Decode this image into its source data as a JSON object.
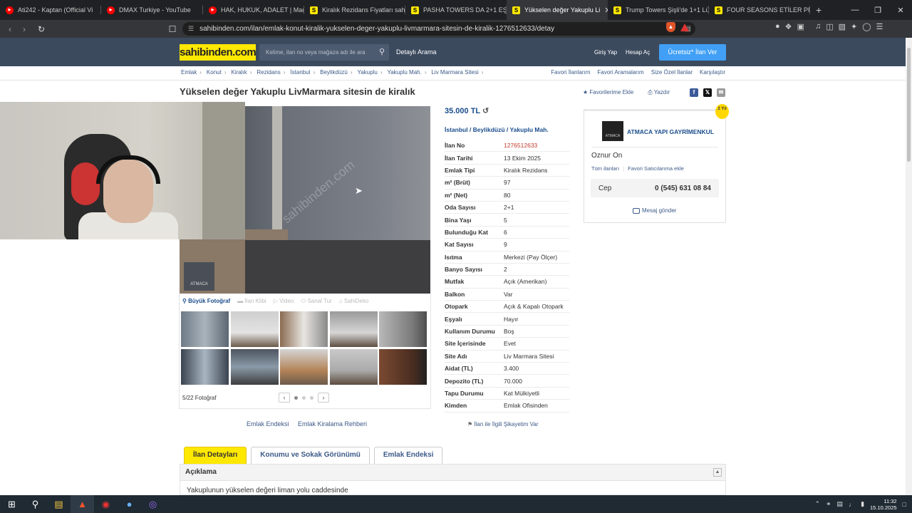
{
  "browser": {
    "tabs": [
      {
        "title": "Ati242 - Kaptan (Official Vi",
        "icon": "youtube-icon",
        "color": "#ff0000",
        "active": false
      },
      {
        "title": "DMAX Turkiye - YouTube",
        "icon": "youtube-icon",
        "color": "#ff0000",
        "active": false
      },
      {
        "title": "HAK, HUKUK, ADALET | Madara",
        "icon": "youtube-icon",
        "color": "#ff0000",
        "active": false
      },
      {
        "title": "Kiralık Rezidans Fiyatları sahibi",
        "icon": "sahibinden-icon",
        "color": "#ffe800",
        "active": false
      },
      {
        "title": "PASHA TOWERS DA 2+1 EŞYAL",
        "icon": "sahibinden-icon",
        "color": "#ffe800",
        "active": false
      },
      {
        "title": "Yükselen değer Yakuplu Li",
        "icon": "sahibinden-icon",
        "color": "#ffe800",
        "active": true
      },
      {
        "title": "Trump Towers Şişli'de 1+1 Lük",
        "icon": "sahibinden-icon",
        "color": "#ffe800",
        "active": false
      },
      {
        "title": "FOUR SEASONS ETİLER PRİVAT",
        "icon": "sahibinden-icon",
        "color": "#ffe800",
        "active": false
      }
    ],
    "url": "sahibinden.com/ilan/emlak-konut-kiralik-yukselen-deger-yakuplu-livmarmara-sitesin-de-kiralik-1276512633/detay"
  },
  "site": {
    "logo": "sahibinden.com",
    "search_placeholder": "Kelime, ilan no veya mağaza adı ile ara",
    "detailed_search": "Detaylı Arama",
    "login": "Giriş Yap",
    "register": "Hesap Aç",
    "post_ad": "Ücretsiz* İlan Ver",
    "brand_yellow": "#ffe800",
    "header_color": "#3c4a5e"
  },
  "breadcrumbs": [
    "Emlak",
    "Konut",
    "Kiralık",
    "Rezidans",
    "İstanbul",
    "Beylikdüzü",
    "Yakuplu",
    "Yakuplu Mah.",
    "Liv Marmara Sitesi"
  ],
  "top_links": [
    "Favori İlanlarım",
    "Favori Aramalarım",
    "Size Özel İlanlar",
    "Karşılaştır"
  ],
  "listing": {
    "title": "Yükselen değer Yakuplu LivMarmara sitesin de kiralık",
    "add_favorite": "Favorilerime Ekle",
    "print": "Yazdır",
    "price": "35.000 TL",
    "location": "İstanbul  /  Beylikdüzü  /  Yakuplu Mah.",
    "photo_tools": [
      "Büyük Fotoğraf",
      "İlan Klibi",
      "Video",
      "Sanal Tur",
      "SahiDeko"
    ],
    "photo_count": "5/22 Fotoğraf",
    "photo_watermark": "sahibinden.com",
    "photo_badge": "ATMACA",
    "under_links": [
      "Emlak Endeksi",
      "Emlak Kiralama Rehberi"
    ],
    "report": "İlan ile İlgili Şikayetim Var",
    "details": [
      {
        "k": "İlan No",
        "v": "1276512633"
      },
      {
        "k": "İlan Tarihi",
        "v": "13 Ekim 2025"
      },
      {
        "k": "Emlak Tipi",
        "v": "Kiralık Rezidans"
      },
      {
        "k": "m² (Brüt)",
        "v": "97"
      },
      {
        "k": "m² (Net)",
        "v": "80"
      },
      {
        "k": "Oda Sayısı",
        "v": "2+1"
      },
      {
        "k": "Bina Yaşı",
        "v": "5"
      },
      {
        "k": "Bulunduğu Kat",
        "v": "6"
      },
      {
        "k": "Kat Sayısı",
        "v": "9"
      },
      {
        "k": "Isıtma",
        "v": "Merkezi (Pay Ölçer)"
      },
      {
        "k": "Banyo Sayısı",
        "v": "2"
      },
      {
        "k": "Mutfak",
        "v": "Açık (Amerikan)"
      },
      {
        "k": "Balkon",
        "v": "Var"
      },
      {
        "k": "Otopark",
        "v": "Açık & Kapalı Otopark"
      },
      {
        "k": "Eşyalı",
        "v": "Hayır"
      },
      {
        "k": "Kullanım Durumu",
        "v": "Boş"
      },
      {
        "k": "Site İçerisinde",
        "v": "Evet"
      },
      {
        "k": "Site Adı",
        "v": "Liv Marmara Sitesi"
      },
      {
        "k": "Aidat (TL)",
        "v": "3.400"
      },
      {
        "k": "Depozito (TL)",
        "v": "70.000"
      },
      {
        "k": "Tapu Durumu",
        "v": "Kat Mülkiyetli"
      },
      {
        "k": "Kimden",
        "v": "Emlak Ofisinden"
      }
    ]
  },
  "seller": {
    "badge": "2 Yıl",
    "logo_text": "ATMACA",
    "name": "ATMACA YAPI GAYRİMENKUL",
    "person": "Oznur On",
    "all_ads": "Tüm ilanları",
    "fav_seller": "Favori Satıcılarıma ekle",
    "phone_label": "Cep",
    "phone": "0 (545) 631 08 84",
    "message": "Mesaj gönder"
  },
  "page_tabs": [
    "İlan Detayları",
    "Konumu ve Sokak Görünümü",
    "Emlak Endeksi"
  ],
  "description": {
    "header": "Açıklama",
    "text": "Yakuplunun yükselen değeri liman yolu caddesinde"
  },
  "taskbar": {
    "time": "11:32",
    "date": "15.10.2025"
  }
}
